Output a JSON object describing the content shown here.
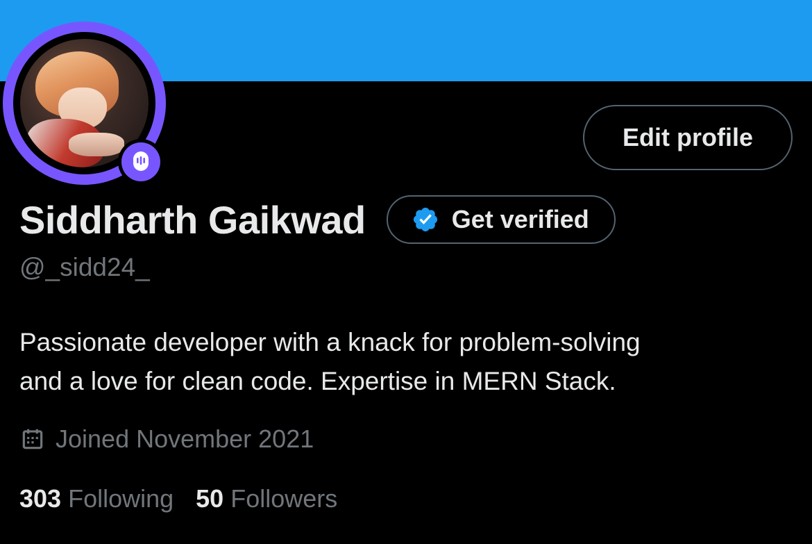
{
  "colors": {
    "banner": "#1d9bf0",
    "background": "#000000",
    "spaces_ring": "#7856ff",
    "verified_badge": "#1d9bf0",
    "text_primary": "#e7e9ea",
    "text_secondary": "#71767b",
    "button_border": "#536471"
  },
  "profile": {
    "display_name": "Siddharth Gaikwad",
    "handle": "@_sidd24_",
    "bio_line1": "Passionate developer with a knack for problem-solving",
    "bio_line2": "and a love for clean code. Expertise in MERN Stack.",
    "joined": "Joined November 2021",
    "avatar_badge_icon": "spaces-mic-icon"
  },
  "buttons": {
    "edit_profile": "Edit profile",
    "get_verified": "Get verified",
    "verified_icon": "verified-check-icon"
  },
  "stats": {
    "following_count": "303",
    "following_label": "Following",
    "followers_count": "50",
    "followers_label": "Followers"
  },
  "icons": {
    "joined": "calendar-icon"
  }
}
